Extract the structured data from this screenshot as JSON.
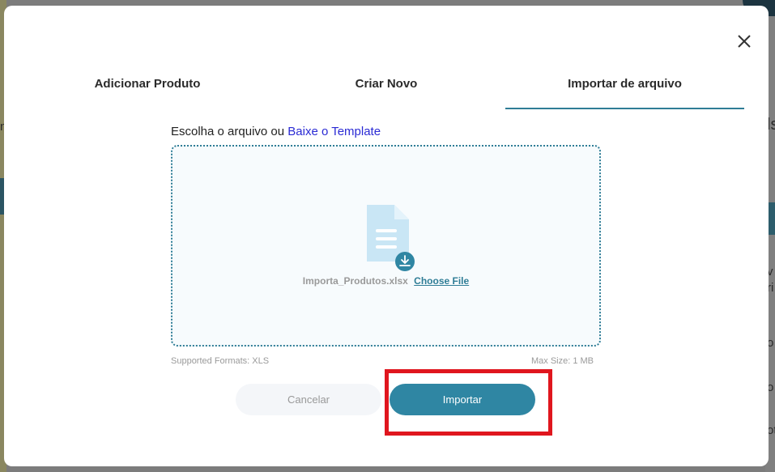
{
  "background": {
    "right_texts": [
      "ls",
      "v",
      "ri",
      "o",
      "o",
      "ot"
    ],
    "left_texts": [
      "n"
    ]
  },
  "modal": {
    "close_icon": "close-icon",
    "tabs": [
      {
        "label": "Adicionar Produto",
        "active": false
      },
      {
        "label": "Criar Novo",
        "active": false
      },
      {
        "label": "Importar de arquivo",
        "active": true
      }
    ],
    "choose_prefix": "Escolha o arquivo ou",
    "template_link": "Baixe o Template",
    "dropzone": {
      "file_icon": "document-download-icon",
      "file_name": "Importa_Produtos.xlsx",
      "choose_file": "Choose File"
    },
    "supported_formats": "Supported Formats: XLS",
    "max_size": "Max Size: 1 MB",
    "cancel_label": "Cancelar",
    "import_label": "Importar"
  },
  "colors": {
    "accent": "#2f86a3",
    "tab_underline": "#2f7d96",
    "link": "#2a2ad4",
    "highlight": "#e0161e"
  }
}
